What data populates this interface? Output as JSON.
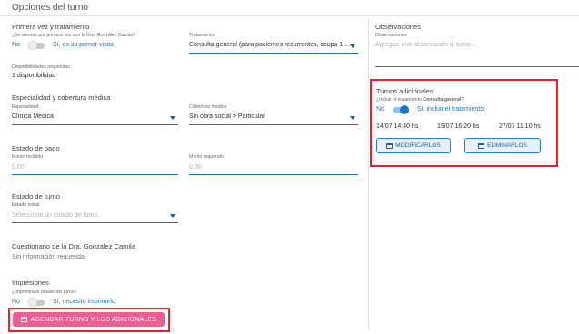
{
  "header": {
    "title": "Opciones del turno"
  },
  "primera_vez": {
    "title": "Primera vez y tratamiento",
    "question": "¿Se atiende por primera vez con la Dra. González Camila?",
    "off_label": "No",
    "on_label": "Sí, es su primer visita"
  },
  "tratamiento": {
    "label": "Tratamiento",
    "value": "Consulta general (para pacientes recurrentes, ocupa 1 ..."
  },
  "disponibilidades": {
    "label": "Disponibilidades requeridas",
    "value": "1 disponibilidad"
  },
  "especialidad_section": {
    "title": "Especialidad y cobertura médica"
  },
  "especialidad": {
    "label": "Especialidad",
    "value": "Clínica Medica"
  },
  "cobertura": {
    "label": "Cobertura médica",
    "value": "Sin obra social > Particular"
  },
  "pago": {
    "title": "Estado de pago",
    "monto_recibido_label": "Monto recibido",
    "monto_recibido_value": "0.00",
    "monto_requerido_label": "Monto requerido",
    "monto_requerido_value": "0.00"
  },
  "estado_turno": {
    "title": "Estado de turno",
    "label": "Estado inicial",
    "placeholder": "Seleccione un estado de turno"
  },
  "cuestionario": {
    "title": "Cuestionario de la Dra. Gonzalez Camila",
    "value": "Sin información requerida"
  },
  "impresiones": {
    "title": "Impresiones",
    "question": "¿Imprimirá el detalle del turno?",
    "off_label": "No",
    "on_label": "Sí, necesito imprimirlo"
  },
  "agendar_button": {
    "label": "AGENDAR TURNO Y LOS ADICIONALES"
  },
  "observaciones": {
    "title": "Observaciones",
    "label": "Observaciones",
    "placeholder": "Agregue una observación al turno..."
  },
  "turnos_adicionales": {
    "title": "Turnos adicionales",
    "question_prefix": "¿Incluir el tratamiento ",
    "question_bold": "Consulta general",
    "question_suffix": "?",
    "off_label": "No",
    "on_label": "Sí, incluir el tratamiento",
    "dates": [
      "14/07 14:40 hs",
      "19/07 16:20 hs",
      "27/07 11:10 hs"
    ],
    "modify_label": "MODIFICARLOS",
    "delete_label": "ELIMINARLOS"
  },
  "colors": {
    "accent": "#1a73c7",
    "highlight": "#e3242b",
    "primary_button": "#ec5f92"
  },
  "icons": [
    "calendar-icon",
    "dropdown-arrow-icon"
  ]
}
